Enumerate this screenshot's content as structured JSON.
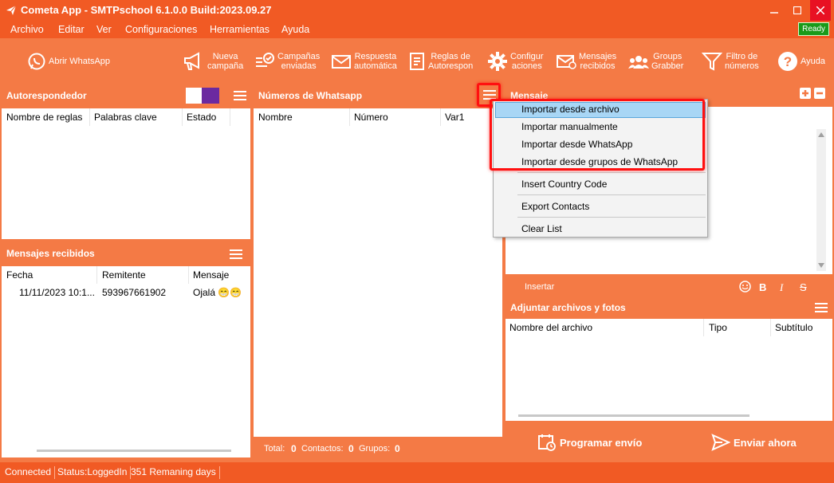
{
  "window": {
    "title": "Cometa App - SMTPschool 6.1.0.0 Build:2023.09.27"
  },
  "menubar": {
    "items": [
      "Archivo",
      "Editar",
      "Ver",
      "Configuraciones",
      "Herramientas",
      "Ayuda"
    ],
    "ready": "Ready"
  },
  "toolbar": {
    "abrir": "Abrir WhatsApp",
    "nueva": [
      "Nueva",
      "campaña"
    ],
    "campanas": [
      "Campañas",
      "enviadas"
    ],
    "respuesta": [
      "Respuesta",
      "automática"
    ],
    "reglas": [
      "Reglas de",
      "Autorespon"
    ],
    "config": [
      "Configur",
      "aciones"
    ],
    "mensajes": [
      "Mensajes",
      "recibidos"
    ],
    "groups": [
      "Groups",
      "Grabber"
    ],
    "filtro": [
      "Filtro de",
      "números"
    ],
    "ayuda": "Ayuda"
  },
  "autoresp": {
    "title": "Autorespondedor",
    "columns": [
      "Nombre de reglas",
      "Palabras clave",
      "Estado"
    ]
  },
  "recibidos": {
    "title": "Mensajes recibidos",
    "columns": [
      "Fecha",
      "Remitente",
      "Mensaje"
    ],
    "rows": [
      {
        "fecha": "11/11/2023 10:1...",
        "remitente": "593967661902",
        "mensaje": "Ojalá 😁😁"
      }
    ]
  },
  "numeros": {
    "title": "Números de Whatsapp",
    "columns": [
      "Nombre",
      "Número",
      "Var1"
    ],
    "footer": {
      "total_label": "Total:",
      "total": "0",
      "contactos_label": "Contactos:",
      "contactos": "0",
      "grupos_label": "Grupos:",
      "grupos": "0"
    }
  },
  "context_menu": {
    "items": [
      "Importar desde archivo",
      "Importar manualmente",
      "Importar desde WhatsApp",
      "Importar desde grupos de WhatsApp",
      "Insert Country Code",
      "Export Contacts",
      "Clear List"
    ]
  },
  "mensaje": {
    "title": "Mensaje",
    "insertar": "Insertar",
    "bold": "B",
    "italic": "I",
    "strike": "S"
  },
  "adjuntar": {
    "title": "Adjuntar archivos y fotos",
    "columns": [
      "Nombre del archivo",
      "Tipo",
      "Subtítulo"
    ]
  },
  "actions": {
    "programar": "Programar envío",
    "enviar": "Enviar ahora"
  },
  "status": {
    "connected": "Connected",
    "login": "Status:LoggedIn",
    "days": "351 Remaning days"
  },
  "colors": {
    "accent": "#f47a45",
    "titlebar": "#f15a24",
    "highlight": "#a8d6f5",
    "annotation": "#ff1010"
  }
}
